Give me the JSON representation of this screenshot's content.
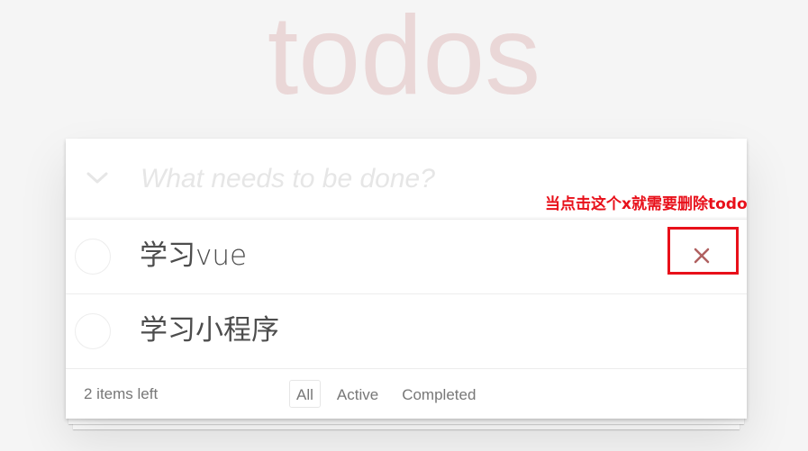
{
  "app": {
    "title": "todos"
  },
  "new_todo": {
    "placeholder": "What needs to be done?",
    "value": ""
  },
  "todos": [
    {
      "label": "学习vue",
      "completed": false
    },
    {
      "label": "学习小程序",
      "completed": false
    }
  ],
  "footer": {
    "count_text": "2 items left",
    "filters": [
      {
        "label": "All",
        "selected": true
      },
      {
        "label": "Active",
        "selected": false
      },
      {
        "label": "Completed",
        "selected": false
      }
    ]
  },
  "annotation": {
    "text": "当点击这个x就需要删除todo",
    "color": "#e8101a"
  },
  "colors": {
    "title": "#efd5d5",
    "destroy_icon": "#b06060",
    "background": "#f5f5f5"
  },
  "icons": {
    "toggle_all": "chevron-down-icon",
    "destroy": "close-icon"
  }
}
